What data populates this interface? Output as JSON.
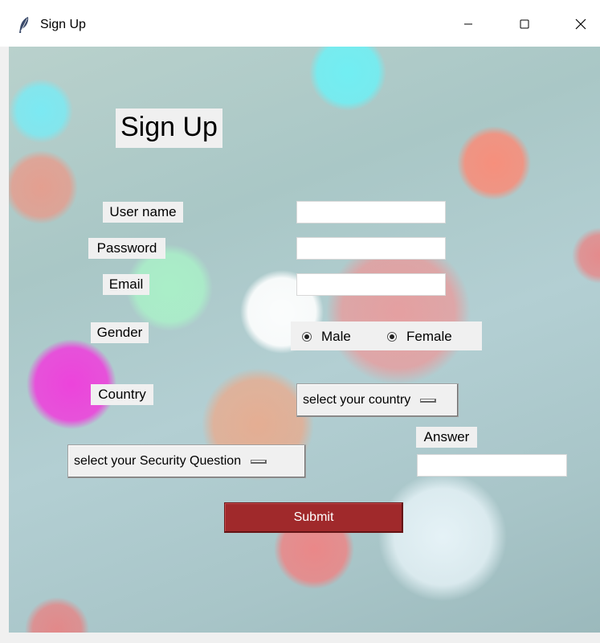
{
  "window": {
    "title": "Sign Up",
    "icon": "feather-icon",
    "controls": [
      "minimize-icon",
      "maximize-icon",
      "close-icon"
    ]
  },
  "form": {
    "heading": "Sign Up",
    "username_label": "User name",
    "username_value": "",
    "password_label": "Password",
    "password_value": "",
    "email_label": "Email",
    "email_value": "",
    "gender_label": "Gender",
    "gender_options": [
      "Male",
      "Female"
    ],
    "country_label": "Country",
    "country_selected": "select your country",
    "security_question_selected": "select your Security Question",
    "answer_label": "Answer",
    "answer_value": "",
    "submit_label": "Submit"
  },
  "colors": {
    "submit_background": "#a0292b",
    "submit_text": "#ffffff",
    "label_background": "#f0f0f0"
  }
}
